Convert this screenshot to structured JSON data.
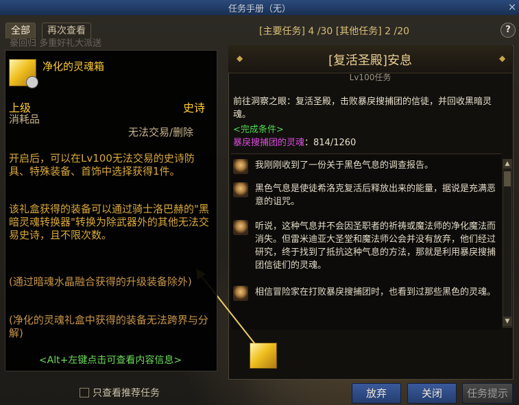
{
  "window": {
    "title": "任务手册（无）",
    "close_label": "×"
  },
  "tabs": [
    {
      "label": "全部"
    },
    {
      "label": "再次查看"
    }
  ],
  "counts": {
    "main_label": "[主要任务]",
    "main_value": "4 /30",
    "other_label": "[其他任务]",
    "other_value": "2 /20"
  },
  "help_label": "?",
  "quest": {
    "title": "[复活圣殿]安息",
    "level": "Lv100任务",
    "description": "前往洞察之眼：复活圣殿，击败暴戾搜捕团的信徒，并回收黑暗灵魂。",
    "condition_label": "<完成条件>",
    "target_name": "暴戾搜捕团的灵魂",
    "target_progress": "：814/1260",
    "dialogs": [
      "我刚刚收到了一份关于黑色气息的调查报告。",
      "黑色气息是使徒希洛克复活后释放出来的能量，据说是充满恶意的诅咒。",
      "听说，这种气息并不会因圣职者的祈祷或魔法师的净化魔法而消失。但雷米迪亚大圣堂和魔法师公会并没有放弃，他们经过研究，终于找到了抵抗这种气息的方法，那就是利用暴戾搜捕团信徒们的灵魂。",
      "相信冒险家在打败暴戾搜捕团时，也看到过那些黑色的灵魂。"
    ]
  },
  "buttons": {
    "abandon": "放弃",
    "close": "关闭",
    "hint": "任务提示"
  },
  "recommend_label": "只查看推荐任务",
  "item": {
    "name": "净化的灵魂箱",
    "grade": "上级",
    "rarity": "史诗",
    "type": "消耗品",
    "trade": "无法交易/删除",
    "desc1": "开启后，可以在Lv100无法交易的史诗防具、特殊装备、首饰中选择获得1件。",
    "desc2": "该礼盒获得的装备可以通过骑士洛巴赫的\"黑暗灵魂转换器\"转换为除武器外的其他无法交易史诗，且不限次数。",
    "note1": "(通过暗魂水晶融合获得的升级装备除外)",
    "note2": "(净化的灵魂礼盒中获得的装备无法跨界与分解)",
    "alt_hint": "<Alt+左键点击可查看内容信息>"
  },
  "colors": {
    "accent": "#ffcc33",
    "condition": "#4fd64f",
    "target": "#e04ae0",
    "button": "#2f4f8a"
  }
}
